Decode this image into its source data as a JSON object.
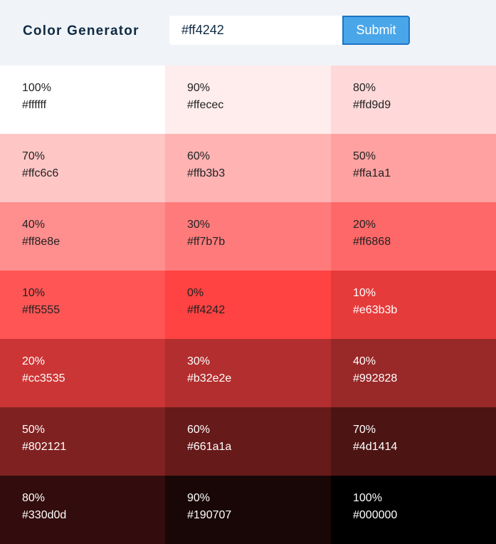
{
  "header": {
    "title": "Color Generator",
    "input_value": "#ff4242",
    "submit_label": "Submit"
  },
  "colors": [
    {
      "weight": "100%",
      "hex": "#ffffff",
      "dark": false
    },
    {
      "weight": "90%",
      "hex": "#ffecec",
      "dark": false
    },
    {
      "weight": "80%",
      "hex": "#ffd9d9",
      "dark": false
    },
    {
      "weight": "70%",
      "hex": "#ffc6c6",
      "dark": false
    },
    {
      "weight": "60%",
      "hex": "#ffb3b3",
      "dark": false
    },
    {
      "weight": "50%",
      "hex": "#ffa1a1",
      "dark": false
    },
    {
      "weight": "40%",
      "hex": "#ff8e8e",
      "dark": false
    },
    {
      "weight": "30%",
      "hex": "#ff7b7b",
      "dark": false
    },
    {
      "weight": "20%",
      "hex": "#ff6868",
      "dark": false
    },
    {
      "weight": "10%",
      "hex": "#ff5555",
      "dark": false
    },
    {
      "weight": "0%",
      "hex": "#ff4242",
      "dark": false
    },
    {
      "weight": "10%",
      "hex": "#e63b3b",
      "dark": true
    },
    {
      "weight": "20%",
      "hex": "#cc3535",
      "dark": true
    },
    {
      "weight": "30%",
      "hex": "#b32e2e",
      "dark": true
    },
    {
      "weight": "40%",
      "hex": "#992828",
      "dark": true
    },
    {
      "weight": "50%",
      "hex": "#802121",
      "dark": true
    },
    {
      "weight": "60%",
      "hex": "#661a1a",
      "dark": true
    },
    {
      "weight": "70%",
      "hex": "#4d1414",
      "dark": true
    },
    {
      "weight": "80%",
      "hex": "#330d0d",
      "dark": true
    },
    {
      "weight": "90%",
      "hex": "#190707",
      "dark": true
    },
    {
      "weight": "100%",
      "hex": "#000000",
      "dark": true
    }
  ]
}
